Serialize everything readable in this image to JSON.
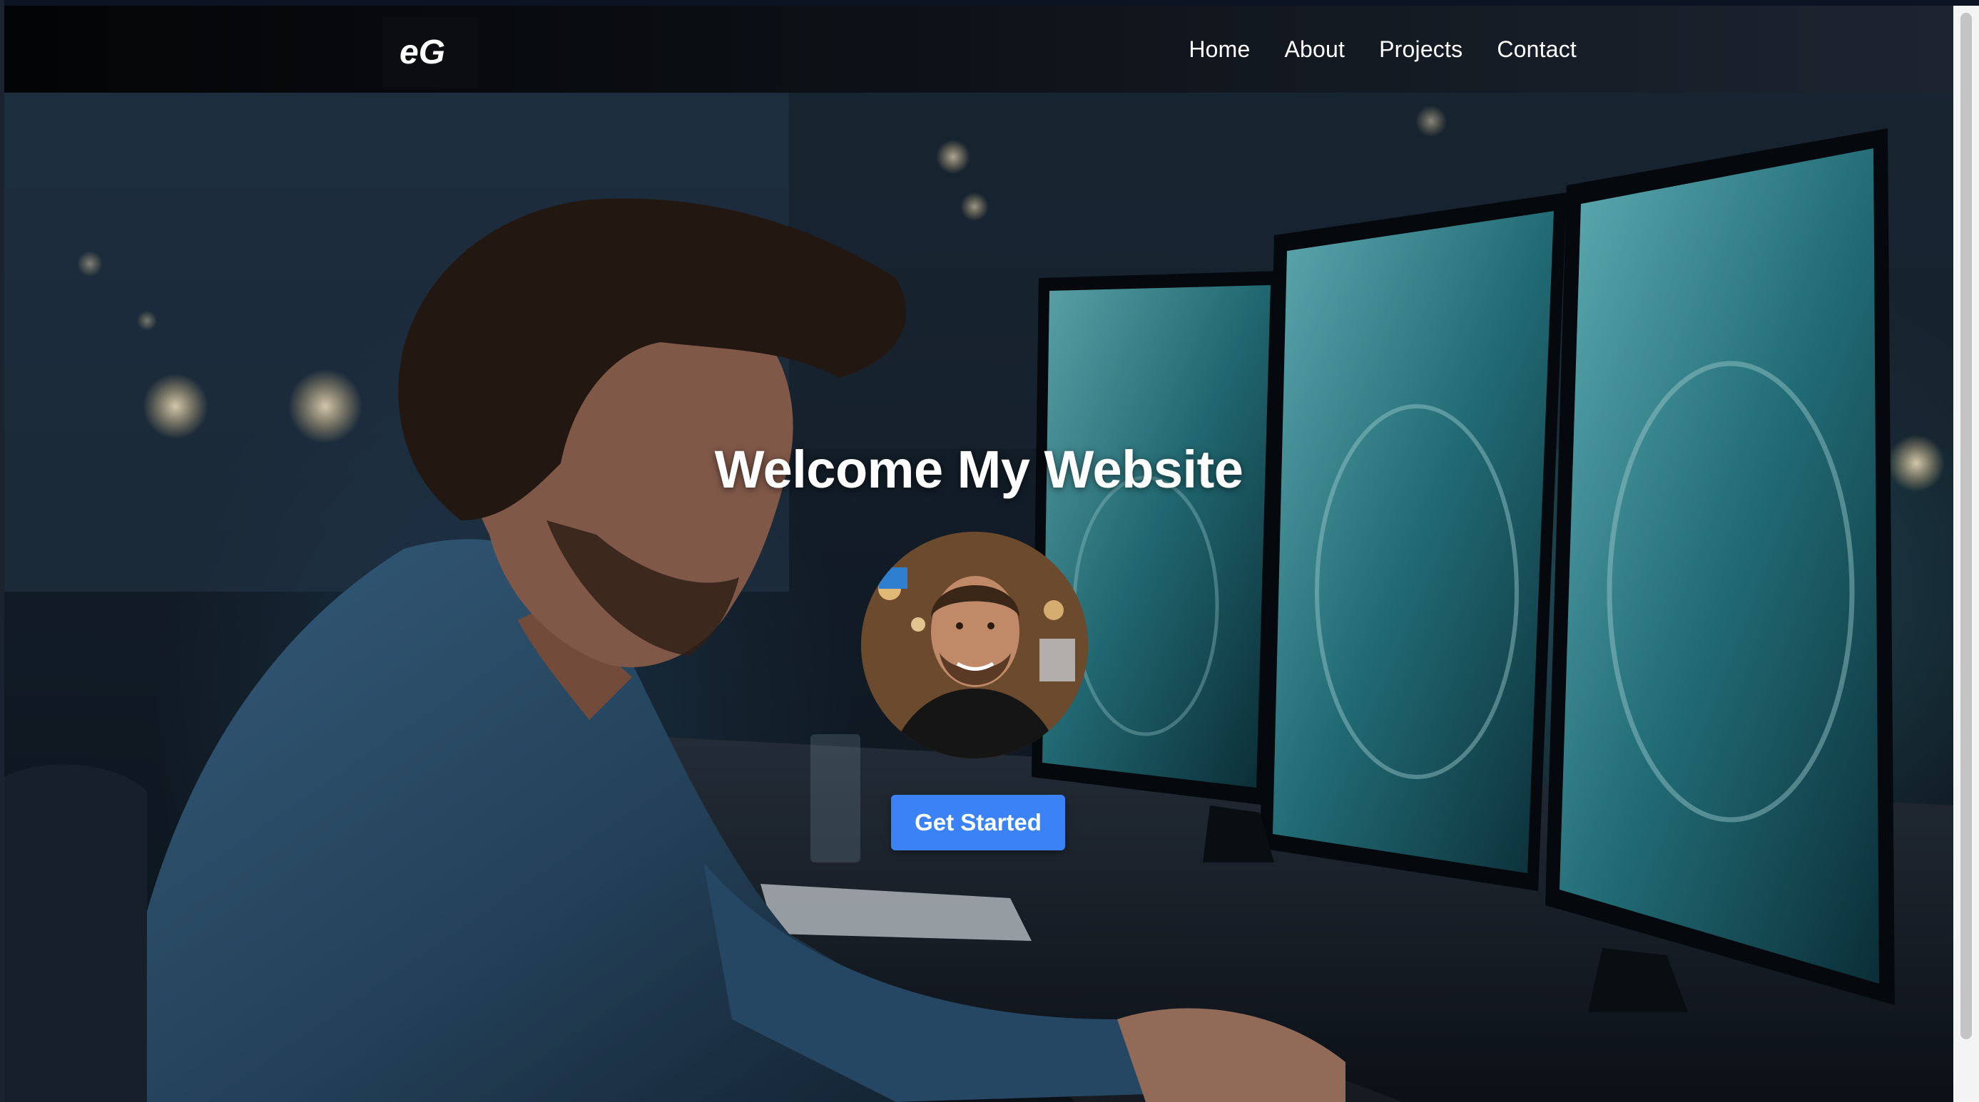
{
  "navbar": {
    "logo_text": "eG",
    "links": [
      "Home",
      "About",
      "Projects",
      "Contact"
    ]
  },
  "hero": {
    "title": "Welcome My Website",
    "cta_label": "Get Started"
  },
  "colors": {
    "accent": "#3b82f6",
    "navbar_bg": "#0a0d12",
    "screen_glow": "#5fd0d8"
  }
}
